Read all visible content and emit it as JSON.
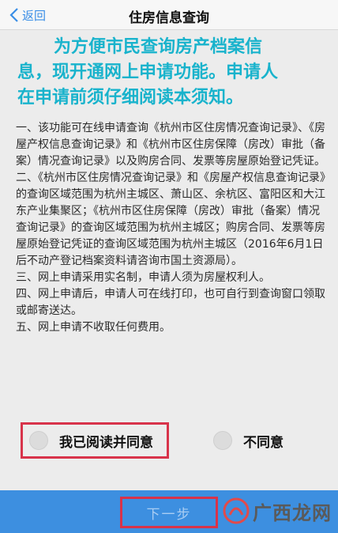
{
  "nav": {
    "back_label": "返回",
    "title": "住房信息查询"
  },
  "headline": {
    "line1": "为方便市民查询房产档案信",
    "line2": "息，现开通网上申请功能。申请人",
    "line3": "在申请前须仔细阅读本须知。"
  },
  "notice": {
    "items": [
      "一、该功能可在线申请查询《杭州市区住房情况查询记录》、《房屋产权信息查询记录》和《杭州市区住房保障（房改）审批（备案）情况查询记录》以及购房合同、发票等房屋原始登记凭证。",
      "二、《杭州市区住房情况查询记录》和《房屋产权信息查询记录》的查询区域范围为杭州主城区、萧山区、余杭区、富阳区和大江东产业集聚区；《杭州市区住房保障（房改）审批（备案）情况查询记录》的查询区域范围为杭州主城区；购房合同、发票等房屋原始登记凭证的查询区域范围为杭州主城区（2016年6月1日后不动产登记档案资料请咨询市国土资源局）。",
      "三、网上申请采用实名制，申请人须为房屋权利人。",
      "四、网上申请后，申请人可在线打印，也可自行到查询窗口领取或邮寄送达。",
      "五、网上申请不收取任何费用。"
    ]
  },
  "options": {
    "agree_label": "我已阅读并同意",
    "disagree_label": "不同意"
  },
  "footer": {
    "next_label": "下一步"
  },
  "watermark": {
    "text": "广西龙网"
  },
  "colors": {
    "headline": "#19b3cc",
    "footer_bg": "#3d8fe0",
    "highlight_border": "#d8334a",
    "back_link": "#3a8ee6"
  }
}
